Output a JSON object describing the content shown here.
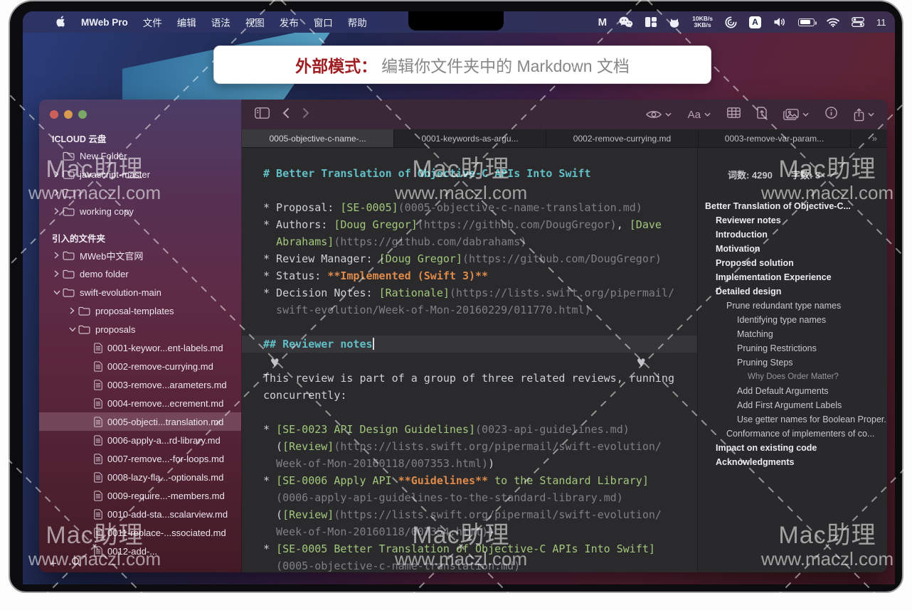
{
  "menu_bar": {
    "app_name": "MWeb Pro",
    "menus": [
      "文件",
      "编辑",
      "语法",
      "视图",
      "发布",
      "窗口",
      "帮助"
    ],
    "status": {
      "net_up": "10KB/s",
      "net_down": "3KB/s",
      "input_letter": "A",
      "time": "11"
    }
  },
  "banner": {
    "prefix": "外部模式：",
    "text": "编辑你文件夹中的 Markdown 文档"
  },
  "toolbar": {
    "aa_label": "Aa"
  },
  "tabs": [
    {
      "label": "0005-objective-c-name-...",
      "active": true
    },
    {
      "label": "0001-keywords-as-argu...",
      "active": false
    },
    {
      "label": "0002-remove-currying.md",
      "active": false
    },
    {
      "label": "0003-remove-var-param...",
      "active": false
    }
  ],
  "tab_overflow": "»",
  "sidebar": {
    "sections": [
      {
        "header": "ICLOUD 云盘",
        "items": [
          {
            "label": "New Folder",
            "type": "folder",
            "chev": "",
            "indent": 0,
            "selected": false
          },
          {
            "label": "javascript-master",
            "type": "folder",
            "chev": "right",
            "indent": 0,
            "selected": false
          },
          {
            "label": "",
            "type": "folder",
            "chev": "right",
            "indent": 0,
            "selected": false
          },
          {
            "label": "working copy",
            "type": "folder",
            "chev": "right",
            "indent": 0,
            "selected": false
          }
        ]
      },
      {
        "header": "引入的文件夹",
        "items": [
          {
            "label": "MWeb中文官网",
            "type": "folder",
            "chev": "right",
            "indent": 0,
            "selected": false
          },
          {
            "label": "demo folder",
            "type": "folder",
            "chev": "right",
            "indent": 0,
            "selected": false
          },
          {
            "label": "swift-evolution-main",
            "type": "folder",
            "chev": "down",
            "indent": 0,
            "selected": false
          },
          {
            "label": "proposal-templates",
            "type": "folder",
            "chev": "right",
            "indent": 1,
            "selected": false
          },
          {
            "label": "proposals",
            "type": "folder",
            "chev": "down",
            "indent": 1,
            "selected": false
          },
          {
            "label": "0001-keywor...ent-labels.md",
            "type": "file",
            "chev": "",
            "indent": 2,
            "selected": false
          },
          {
            "label": "0002-remove-currying.md",
            "type": "file",
            "chev": "",
            "indent": 2,
            "selected": false
          },
          {
            "label": "0003-remove...arameters.md",
            "type": "file",
            "chev": "",
            "indent": 2,
            "selected": false
          },
          {
            "label": "0004-remove...ecrement.md",
            "type": "file",
            "chev": "",
            "indent": 2,
            "selected": false
          },
          {
            "label": "0005-objecti...translation.md",
            "type": "file",
            "chev": "",
            "indent": 2,
            "selected": true
          },
          {
            "label": "0006-apply-a...rd-library.md",
            "type": "file",
            "chev": "",
            "indent": 2,
            "selected": false
          },
          {
            "label": "0007-remove...-for-loops.md",
            "type": "file",
            "chev": "",
            "indent": 2,
            "selected": false
          },
          {
            "label": "0008-lazy-fla...-optionals.md",
            "type": "file",
            "chev": "",
            "indent": 2,
            "selected": false
          },
          {
            "label": "0009-require...-members.md",
            "type": "file",
            "chev": "",
            "indent": 2,
            "selected": false
          },
          {
            "label": "0010-add-sta...scalarview.md",
            "type": "file",
            "chev": "",
            "indent": 2,
            "selected": false
          },
          {
            "label": "0011-replace-...ssociated.md",
            "type": "file",
            "chev": "",
            "indent": 2,
            "selected": false
          },
          {
            "label": "0012-add-...",
            "type": "file",
            "chev": "",
            "indent": 2,
            "selected": false
          }
        ]
      }
    ]
  },
  "editor": {
    "lines": [
      {
        "segs": [
          [
            "h",
            "# Better Translation of Objective-C APIs Into Swift"
          ]
        ]
      },
      {
        "segs": []
      },
      {
        "segs": [
          [
            "p",
            "* Proposal: "
          ],
          [
            "g",
            "[SE-0005]"
          ],
          [
            "u",
            "(0005-objective-c-name-translation.md)"
          ]
        ]
      },
      {
        "segs": [
          [
            "p",
            "* Authors: "
          ],
          [
            "g",
            "[Doug Gregor]"
          ],
          [
            "u",
            "(https://github.com/DougGregor)"
          ],
          [
            "p",
            ", "
          ],
          [
            "g",
            "[Dave"
          ]
        ]
      },
      {
        "segs": [
          [
            "p",
            "  "
          ],
          [
            "g",
            "Abrahams]"
          ],
          [
            "u",
            "(https://github.com/dabrahams)"
          ]
        ]
      },
      {
        "segs": [
          [
            "p",
            "* Review Manager: "
          ],
          [
            "g",
            "[Doug Gregor]"
          ],
          [
            "u",
            "(https://github.com/DougGregor)"
          ]
        ]
      },
      {
        "segs": [
          [
            "p",
            "* Status: "
          ],
          [
            "o",
            "**Implemented (Swift 3)**"
          ]
        ]
      },
      {
        "segs": [
          [
            "p",
            "* Decision Notes: "
          ],
          [
            "g",
            "[Rationale]"
          ],
          [
            "u",
            "(https://lists.swift.org/pipermail/"
          ]
        ]
      },
      {
        "segs": [
          [
            "u",
            "  swift-evolution/Week-of-Mon-20160229/011770.html)"
          ]
        ]
      },
      {
        "segs": []
      },
      {
        "segs": [
          [
            "h",
            "## Reviewer notes"
          ]
        ],
        "hl": true,
        "cursor": true
      },
      {
        "segs": []
      },
      {
        "segs": [
          [
            "p",
            "This review is part of a group of three related reviews, running"
          ]
        ]
      },
      {
        "segs": [
          [
            "p",
            "concurrently:"
          ]
        ]
      },
      {
        "segs": []
      },
      {
        "segs": [
          [
            "p",
            "* "
          ],
          [
            "g",
            "[SE-0023 API Design Guidelines]"
          ],
          [
            "u",
            "(0023-api-guidelines.md)"
          ]
        ]
      },
      {
        "segs": [
          [
            "p",
            "  ("
          ],
          [
            "g",
            "[Review]"
          ],
          [
            "u",
            "(https://lists.swift.org/pipermail/swift-evolution/"
          ]
        ]
      },
      {
        "segs": [
          [
            "u",
            "  Week-of-Mon-20160118/007353.html)"
          ],
          [
            "p",
            ")"
          ]
        ]
      },
      {
        "segs": [
          [
            "p",
            "* "
          ],
          [
            "g",
            "[SE-0006 Apply API "
          ],
          [
            "o",
            "**Guidelines**"
          ],
          [
            "g",
            " to the Standard Library]"
          ]
        ]
      },
      {
        "segs": [
          [
            "u",
            "  (0006-apply-api-guidelines-to-the-standard-library.md)"
          ]
        ]
      },
      {
        "segs": [
          [
            "p",
            "  ("
          ],
          [
            "g",
            "[Review]"
          ],
          [
            "u",
            "(https://lists.swift.org/pipermail/swift-evolution/"
          ]
        ]
      },
      {
        "segs": [
          [
            "u",
            "  Week-of-Mon-20160118/007354.html)"
          ],
          [
            "p",
            ")"
          ]
        ]
      },
      {
        "segs": [
          [
            "p",
            "* "
          ],
          [
            "g",
            "[SE-0005 Better Translation of Objective-C APIs Into Swift]"
          ]
        ]
      },
      {
        "segs": [
          [
            "u",
            "  (0005-objective-c-name-translation.md)"
          ]
        ]
      }
    ]
  },
  "outline": {
    "stats": {
      "words": "词数: 4290",
      "chars": "字数: 3"
    },
    "items": [
      [
        "Better Translation of Objective-C...",
        0,
        "b"
      ],
      [
        "Reviewer notes",
        1,
        "b"
      ],
      [
        "Introduction",
        1,
        "b"
      ],
      [
        "Motivation",
        1,
        "b"
      ],
      [
        "Proposed solution",
        1,
        "b"
      ],
      [
        "Implementation Experience",
        1,
        "b"
      ],
      [
        "Detailed design",
        1,
        "b"
      ],
      [
        "Prune redundant type names",
        2,
        "r"
      ],
      [
        "Identifying type names",
        3,
        "r"
      ],
      [
        "Matching",
        3,
        "r"
      ],
      [
        "Pruning Restrictions",
        3,
        "r"
      ],
      [
        "Pruning Steps",
        3,
        "r"
      ],
      [
        "Why Does Order Matter?",
        4,
        "d"
      ],
      [
        "Add Default Arguments",
        3,
        "r"
      ],
      [
        "Add First Argument Labels",
        3,
        "r"
      ],
      [
        "Use getter names for Boolean Proper...",
        3,
        "r"
      ],
      [
        "Conformance of implementers of co...",
        2,
        "r"
      ],
      [
        "Impact on existing code",
        1,
        "b"
      ],
      [
        "Acknowledgments",
        1,
        "b"
      ]
    ]
  },
  "watermark": {
    "line1": "Mac助理",
    "line2": "www.maczl.com"
  },
  "colors": {
    "traffic_red": "#cd6159",
    "traffic_yellow": "#d99a52",
    "traffic_green": "#7aa765",
    "heading": "#61bfc6",
    "link": "#a3c87d",
    "url": "#7e8084",
    "status_orange": "#e08a4b"
  }
}
